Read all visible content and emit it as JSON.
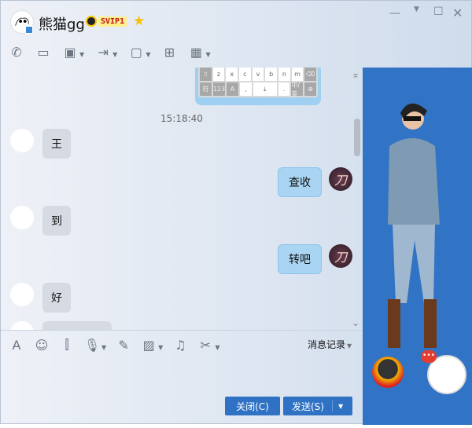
{
  "header": {
    "contact_name": "熊猫gg",
    "vip_badge": "SVIP1",
    "star_level": "2"
  },
  "window_controls": [
    "minimize",
    "maximize",
    "close"
  ],
  "toolbar": [
    {
      "icon": "phone-icon"
    },
    {
      "icon": "video-icon"
    },
    {
      "icon": "screen-share-icon"
    },
    {
      "icon": "file-transfer-icon"
    },
    {
      "icon": "remote-desktop-icon"
    },
    {
      "icon": "group-chat-icon"
    },
    {
      "icon": "apps-icon"
    }
  ],
  "keyboard_image": {
    "row1": [
      "z",
      "x",
      "c",
      "v",
      "b",
      "n",
      "m"
    ],
    "row2": [
      "符",
      "123",
      ",",
      ".",
      "中/英"
    ]
  },
  "messages": {
    "timestamp": "15:18:40",
    "items": [
      {
        "side": "left",
        "text": "王"
      },
      {
        "side": "right",
        "text": "查收"
      },
      {
        "side": "left",
        "text": "到"
      },
      {
        "side": "right",
        "text": "转吧"
      },
      {
        "side": "left",
        "text": "好"
      }
    ]
  },
  "input_toolbar": {
    "history_label": "消息记录"
  },
  "buttons": {
    "close": "关闭(C)",
    "send": "发送(S)"
  },
  "colors": {
    "accent": "#2f72c4",
    "side_panel": "#3173c4",
    "bubble_right": "#a9d5f3"
  }
}
